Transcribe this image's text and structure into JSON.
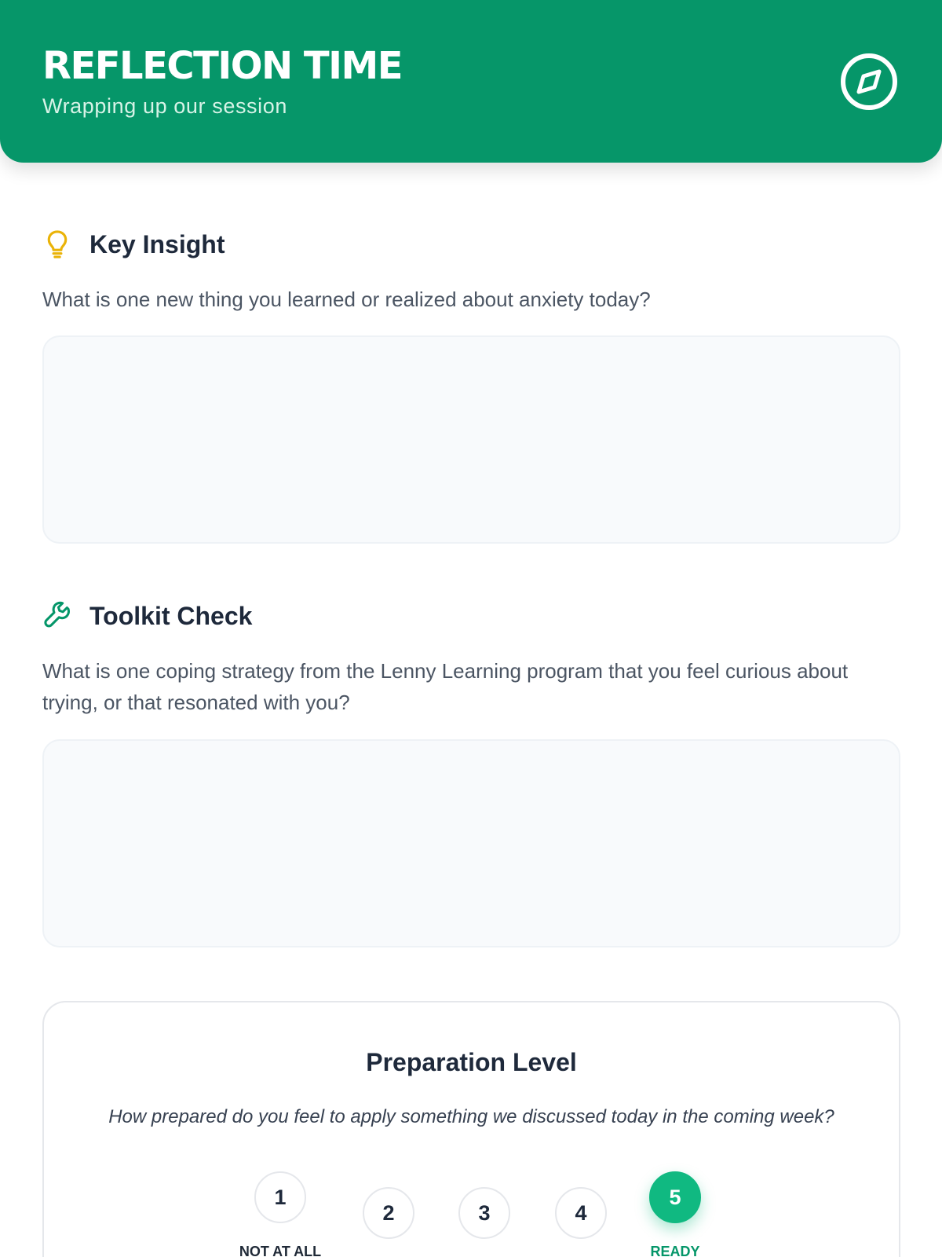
{
  "header": {
    "title": "REFLECTION TIME",
    "subtitle": "Wrapping up our session",
    "nav_icon": "compass-icon",
    "background": "#069669"
  },
  "sections": [
    {
      "icon": "lightbulb-icon",
      "icon_color": "#eab308",
      "title": "Key Insight",
      "prompt": "What is one new thing you learned or realized about anxiety today?",
      "answer_value": ""
    },
    {
      "icon": "wrench-icon",
      "icon_color": "#059669",
      "title": "Toolkit Check",
      "prompt": "What is one coping strategy from the Lenny Learning program that you feel curious about trying, or that resonated with you?",
      "answer_value": ""
    }
  ],
  "preparation": {
    "title": "Preparation Level",
    "question": "How prepared do you feel to apply something we discussed today in the coming week?",
    "options": [
      "1",
      "2",
      "3",
      "4",
      "5"
    ],
    "selected": "5",
    "low_label": "NOT AT ALL",
    "high_label": "READY",
    "accent": "#10b981"
  }
}
